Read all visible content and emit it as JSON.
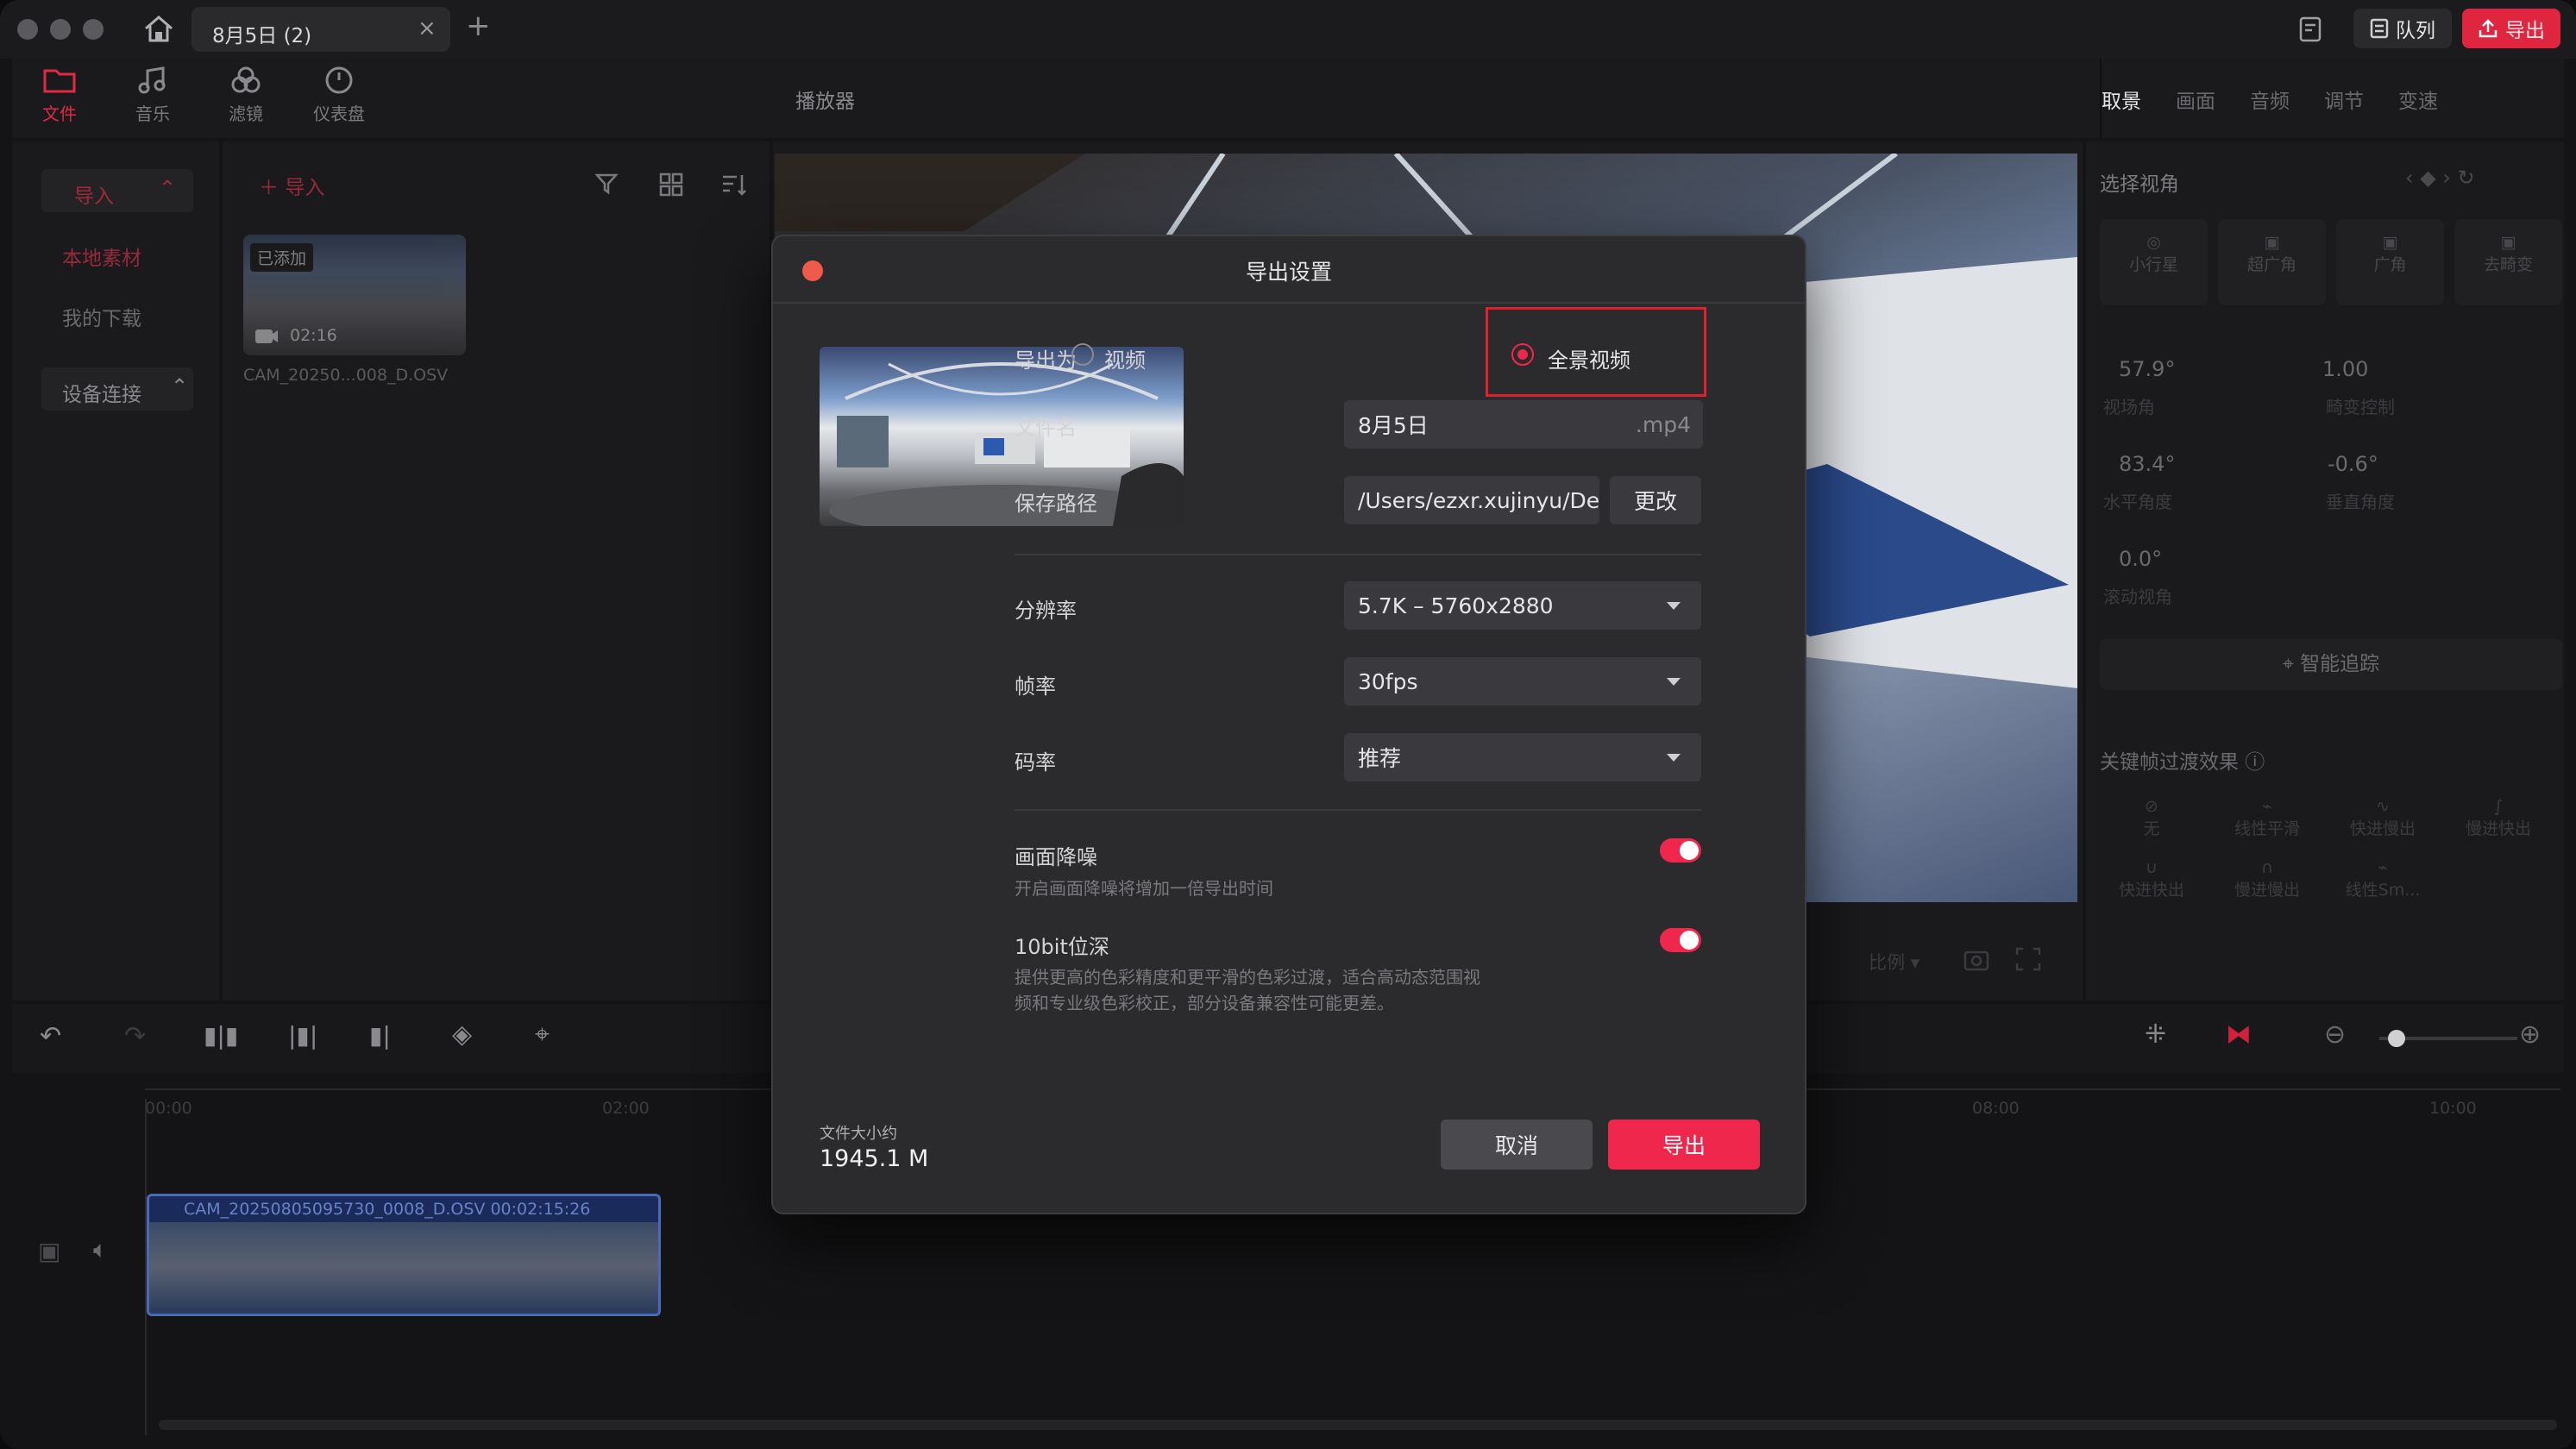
{
  "titlebar": {
    "tab_title": "8月5日 (2)",
    "queue_label": "队列",
    "export_label": "导出"
  },
  "toolbar": {
    "tools": [
      "文件",
      "音乐",
      "滤镜",
      "仪表盘"
    ]
  },
  "library": {
    "import_section": "导入",
    "local_assets": "本地素材",
    "my_downloads": "我的下载",
    "device_connect": "设备连接",
    "import_button": "导入",
    "clip": {
      "badge": "已添加",
      "duration": "02:16",
      "name": "CAM_20250...008_D.OSV"
    }
  },
  "player": {
    "title": "播放器",
    "ratio_label": "比例"
  },
  "right_panel": {
    "tabs": [
      "取景",
      "画面",
      "音频",
      "调节",
      "变速"
    ],
    "select_view": "选择视角",
    "view_modes": [
      "小行星",
      "超广角",
      "广角",
      "去畸变"
    ],
    "params": [
      {
        "value": "57.9°",
        "label": "视场角"
      },
      {
        "value": "1.00",
        "label": "畸变控制"
      },
      {
        "value": "83.4°",
        "label": "水平角度"
      },
      {
        "value": "-0.6°",
        "label": "垂直角度"
      },
      {
        "value": "0.0°",
        "label": "滚动视角"
      }
    ],
    "smart_track": "智能追踪",
    "keyframe_title": "关键帧过渡效果",
    "transitions": [
      "无",
      "线性平滑",
      "快进慢出",
      "慢进快出",
      "快进快出",
      "慢进慢出",
      "线性Sm..."
    ]
  },
  "timeline": {
    "times": [
      "00:00",
      "02:00",
      "08:00",
      "10:00"
    ],
    "clip_label": "CAM_20250805095730_0008_D.OSV  00:02:15:26"
  },
  "dialog": {
    "title": "导出设置",
    "export_as_label": "导出为",
    "option_video": "视频",
    "option_panorama": "全景视频",
    "selected_option": "全景视频",
    "filename_label": "文件名",
    "filename_value": "8月5日",
    "filename_ext": ".mp4",
    "savepath_label": "保存路径",
    "savepath_value": "/Users/ezxr.xujinyu/Desk...",
    "change_button": "更改",
    "resolution_label": "分辨率",
    "resolution_value": "5.7K – 5760x2880",
    "framerate_label": "帧率",
    "framerate_value": "30fps",
    "bitrate_label": "码率",
    "bitrate_value": "推荐",
    "denoise_label": "画面降噪",
    "denoise_desc": "开启画面降噪将增加一倍导出时间",
    "denoise_on": true,
    "bitdepth_label": "10bit位深",
    "bitdepth_desc_1": "提供更高的色彩精度和更平滑的色彩过渡，适合高动态范围视",
    "bitdepth_desc_2": "频和专业级色彩校正，部分设备兼容性可能更差。",
    "bitdepth_on": true,
    "filesize_label": "文件大小约",
    "filesize_value": "1945.1 M",
    "cancel_button": "取消",
    "export_button": "导出"
  },
  "colors": {
    "accent": "#f0274d",
    "highlight_box": "#e0202a",
    "bg": "#141416",
    "dialog_bg": "#2b2b2e"
  }
}
